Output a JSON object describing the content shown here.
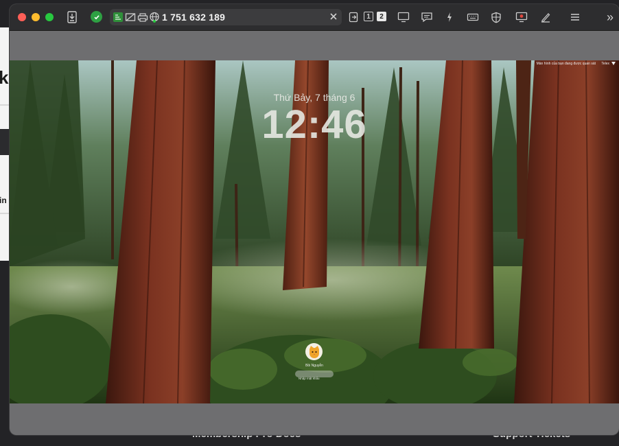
{
  "background_page": {
    "left_fragment_heading": "k",
    "left_fragment_text": "in",
    "footer_left": "Membership Pro Docs",
    "footer_right": "Support Tickets"
  },
  "toolbar": {
    "connection_id": "1 751 632 189",
    "monitors": [
      "1",
      "2"
    ],
    "active_monitor": "2"
  },
  "remote_screen": {
    "date": "Thứ Bảy, 7 tháng 6",
    "time": "12:46",
    "menubar_text": "Màn hình của bạn đang được quan sát",
    "menubar_lang": "Telex",
    "user_name": "Bồi Nguyễn",
    "password_placeholder": "Nhập mật khẩu"
  },
  "colors": {
    "titlebar": "#2d2d2f",
    "connected_green": "#2ea043",
    "close_red": "#ff5f57",
    "minimize_yellow": "#febc2e",
    "zoom_green": "#28c840"
  }
}
